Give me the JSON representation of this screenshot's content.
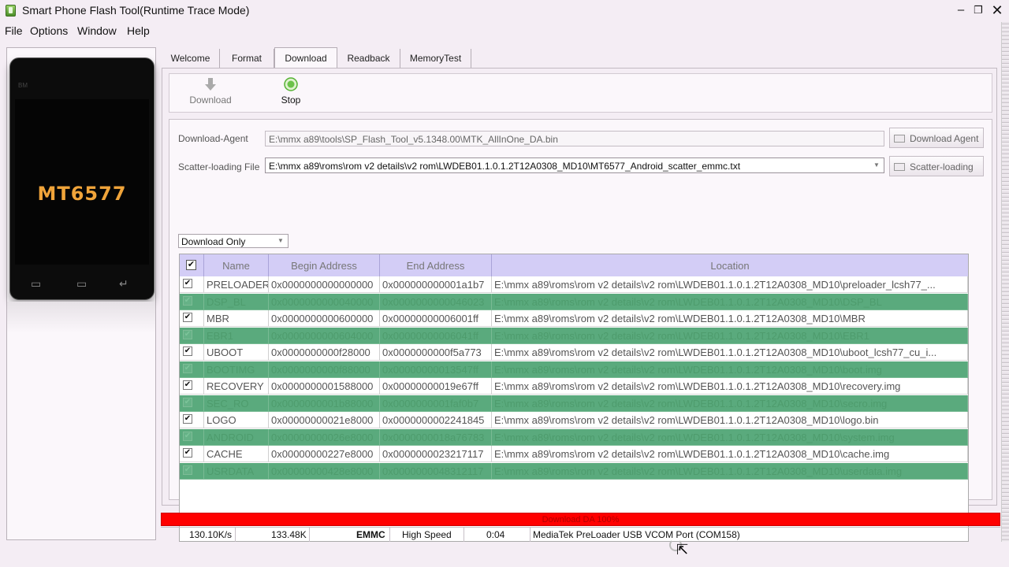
{
  "window": {
    "title": "Smart Phone Flash Tool(Runtime Trace Mode)",
    "min_glyph": "–",
    "max_glyph": "❐",
    "close_glyph": "✕"
  },
  "menu": [
    "File",
    "Options",
    "Window",
    "Help"
  ],
  "phone": {
    "brand_mark": "BM",
    "chip": "MT6577",
    "keys": [
      "▭",
      "▭",
      "↵"
    ]
  },
  "tabs": [
    {
      "label": "Welcome",
      "active": false
    },
    {
      "label": "Format",
      "active": false
    },
    {
      "label": "Download",
      "active": true
    },
    {
      "label": "Readback",
      "active": false
    },
    {
      "label": "MemoryTest",
      "active": false
    }
  ],
  "toolbar": {
    "download_label": "Download",
    "stop_label": "Stop",
    "download_icon": "download-arrow-icon",
    "stop_icon": "stop-circle-icon"
  },
  "download_agent": {
    "label": "Download-Agent",
    "value": "E:\\mmx a89\\tools\\SP_Flash_Tool_v5.1348.00\\MTK_AllInOne_DA.bin",
    "button": "Download Agent"
  },
  "scatter": {
    "label": "Scatter-loading File",
    "value": "E:\\mmx a89\\roms\\rom v2 details\\v2 rom\\LWDEB01.1.0.1.2T12A0308_MD10\\MT6577_Android_scatter_emmc.txt",
    "button": "Scatter-loading"
  },
  "mode": {
    "selected": "Download Only"
  },
  "table": {
    "headers": [
      "Name",
      "Begin Address",
      "End Address",
      "Location"
    ],
    "header_check": "✔",
    "rows": [
      {
        "name": "PRELOADER",
        "begin": "0x0000000000000000",
        "end": "0x000000000001a1b7",
        "location": "E:\\mmx a89\\roms\\rom v2 details\\v2 rom\\LWDEB01.1.0.1.2T12A0308_MD10\\preloader_lcsh77_...",
        "enabled": true
      },
      {
        "name": "DSP_BL",
        "begin": "0x0000000000040000",
        "end": "0x0000000000046023",
        "location": "E:\\mmx a89\\roms\\rom v2 details\\v2 rom\\LWDEB01.1.0.1.2T12A0308_MD10\\DSP_BL",
        "enabled": false
      },
      {
        "name": "MBR",
        "begin": "0x0000000000600000",
        "end": "0x00000000006001ff",
        "location": "E:\\mmx a89\\roms\\rom v2 details\\v2 rom\\LWDEB01.1.0.1.2T12A0308_MD10\\MBR",
        "enabled": true
      },
      {
        "name": "EBR1",
        "begin": "0x0000000000604000",
        "end": "0x00000000006041ff",
        "location": "E:\\mmx a89\\roms\\rom v2 details\\v2 rom\\LWDEB01.1.0.1.2T12A0308_MD10\\EBR1",
        "enabled": false
      },
      {
        "name": "UBOOT",
        "begin": "0x0000000000f28000",
        "end": "0x0000000000f5a773",
        "location": "E:\\mmx a89\\roms\\rom v2 details\\v2 rom\\LWDEB01.1.0.1.2T12A0308_MD10\\uboot_lcsh77_cu_i...",
        "enabled": true
      },
      {
        "name": "BOOTIMG",
        "begin": "0x0000000000f88000",
        "end": "0x00000000013547ff",
        "location": "E:\\mmx a89\\roms\\rom v2 details\\v2 rom\\LWDEB01.1.0.1.2T12A0308_MD10\\boot.img",
        "enabled": false
      },
      {
        "name": "RECOVERY",
        "begin": "0x0000000001588000",
        "end": "0x00000000019e67ff",
        "location": "E:\\mmx a89\\roms\\rom v2 details\\v2 rom\\LWDEB01.1.0.1.2T12A0308_MD10\\recovery.img",
        "enabled": true
      },
      {
        "name": "SEC_RO",
        "begin": "0x0000000001b88000",
        "end": "0x0000000001faf0b7",
        "location": "E:\\mmx a89\\roms\\rom v2 details\\v2 rom\\LWDEB01.1.0.1.2T12A0308_MD10\\secro.img",
        "enabled": false
      },
      {
        "name": "LOGO",
        "begin": "0x00000000021e8000",
        "end": "0x0000000002241845",
        "location": "E:\\mmx a89\\roms\\rom v2 details\\v2 rom\\LWDEB01.1.0.1.2T12A0308_MD10\\logo.bin",
        "enabled": true
      },
      {
        "name": "ANDROID",
        "begin": "0x00000000026e8000",
        "end": "0x0000000018a76783",
        "location": "E:\\mmx a89\\roms\\rom v2 details\\v2 rom\\LWDEB01.1.0.1.2T12A0308_MD10\\system.img",
        "enabled": false
      },
      {
        "name": "CACHE",
        "begin": "0x00000000227e8000",
        "end": "0x0000000023217117",
        "location": "E:\\mmx a89\\roms\\rom v2 details\\v2 rom\\LWDEB01.1.0.1.2T12A0308_MD10\\cache.img",
        "enabled": true
      },
      {
        "name": "USRDATA",
        "begin": "0x00000000428e8000",
        "end": "0x0000000048312117",
        "location": "E:\\mmx a89\\roms\\rom v2 details\\v2 rom\\LWDEB01.1.0.1.2T12A0308_MD10\\userdata.img",
        "enabled": false
      }
    ]
  },
  "progress": {
    "text": "Download DA 100%",
    "percent": 100,
    "color": "#ff0000"
  },
  "status": {
    "speed": "130.10K/s",
    "size": "133.48K",
    "storage": "EMMC",
    "usb_speed": "High Speed",
    "time": "0:04",
    "port": "MediaTek PreLoader USB VCOM Port (COM158)"
  },
  "colors": {
    "disabled_row": "#5aaa7d",
    "table_header": "#d3cdf6"
  }
}
